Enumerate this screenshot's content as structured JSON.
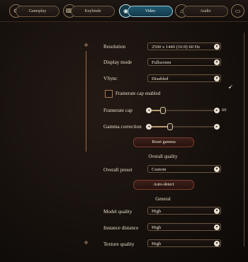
{
  "tabs": [
    {
      "label": "Gameplay",
      "icon": "gameplay-icon",
      "glyph": "⚙"
    },
    {
      "label": "Keybinds",
      "icon": "keybinds-icon",
      "glyph": "⌨"
    },
    {
      "label": "Video",
      "icon": "video-icon",
      "glyph": "◉",
      "active": true
    },
    {
      "label": "Audio",
      "icon": "audio-icon",
      "glyph": "♫"
    },
    {
      "label": "",
      "icon": "monitor-icon",
      "glyph": "▭"
    }
  ],
  "settings": {
    "resolution": {
      "label": "Resolution",
      "value": "2560 x 1440 (16:9) 60 Hz"
    },
    "display_mode": {
      "label": "Display mode",
      "value": "Fullscreen"
    },
    "vsync": {
      "label": "VSync",
      "value": "Disabled"
    },
    "framerate_cap_enabled": {
      "label": "Framerate cap enabled",
      "checked": false
    },
    "framerate_cap": {
      "label": "Framerate cap",
      "value": "60",
      "level": 0.15
    },
    "gamma_correction": {
      "label": "Gamma correction",
      "level": 0.28
    },
    "reset_gamma": "Reset gamma",
    "overall_quality_heading": "Overall quality",
    "overall_preset": {
      "label": "Overall preset",
      "value": "Custom"
    },
    "auto_detect": "Auto-detect",
    "general_heading": "General",
    "model_quality": {
      "label": "Model quality",
      "value": "High"
    },
    "instance_distance": {
      "label": "Instance distance",
      "value": "High"
    },
    "texture_quality": {
      "label": "Texture quality",
      "value": "High"
    }
  },
  "glyphs": {
    "dropdown": "▾",
    "left": "◂",
    "right": "▸",
    "scroll": "✥"
  },
  "colors": {
    "accent_active_tab": "#1f5a70",
    "button_border": "#7a3b2e",
    "scroll_line": "#a36a3f"
  }
}
